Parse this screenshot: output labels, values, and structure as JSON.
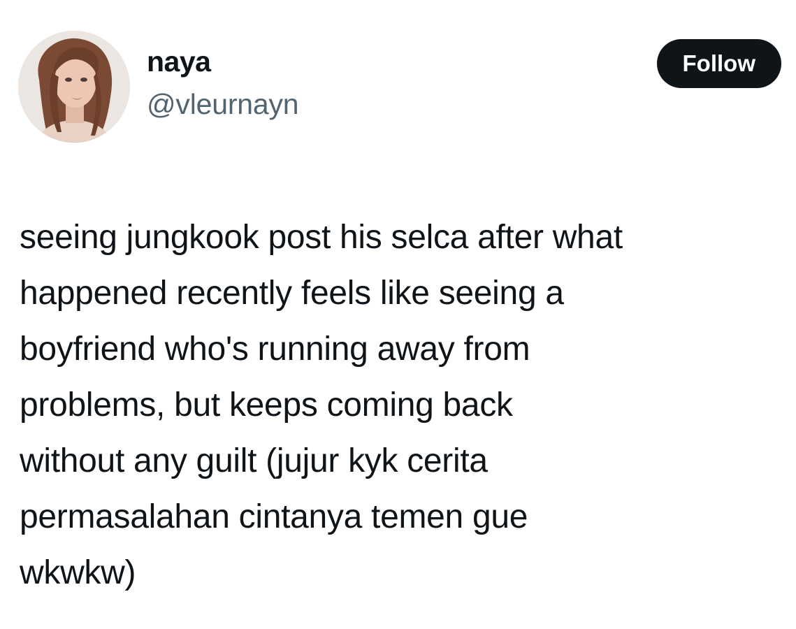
{
  "author": {
    "display_name": "naya",
    "handle": "@vleurnayn",
    "avatar_icon": "profile-photo"
  },
  "actions": {
    "follow_label": "Follow"
  },
  "tweet": {
    "text": "seeing jungkook post his selca after what\nhappened recently feels like seeing a\nboyfriend who's running away from\nproblems, but keeps coming back\nwithout any guilt (jujur kyk cerita\npermasalahan cintanya temen gue\nwkwkw)"
  },
  "colors": {
    "text_primary": "#0f1419",
    "text_secondary": "#536471",
    "button_bg": "#0f1419",
    "button_text": "#ffffff",
    "background": "#ffffff"
  }
}
